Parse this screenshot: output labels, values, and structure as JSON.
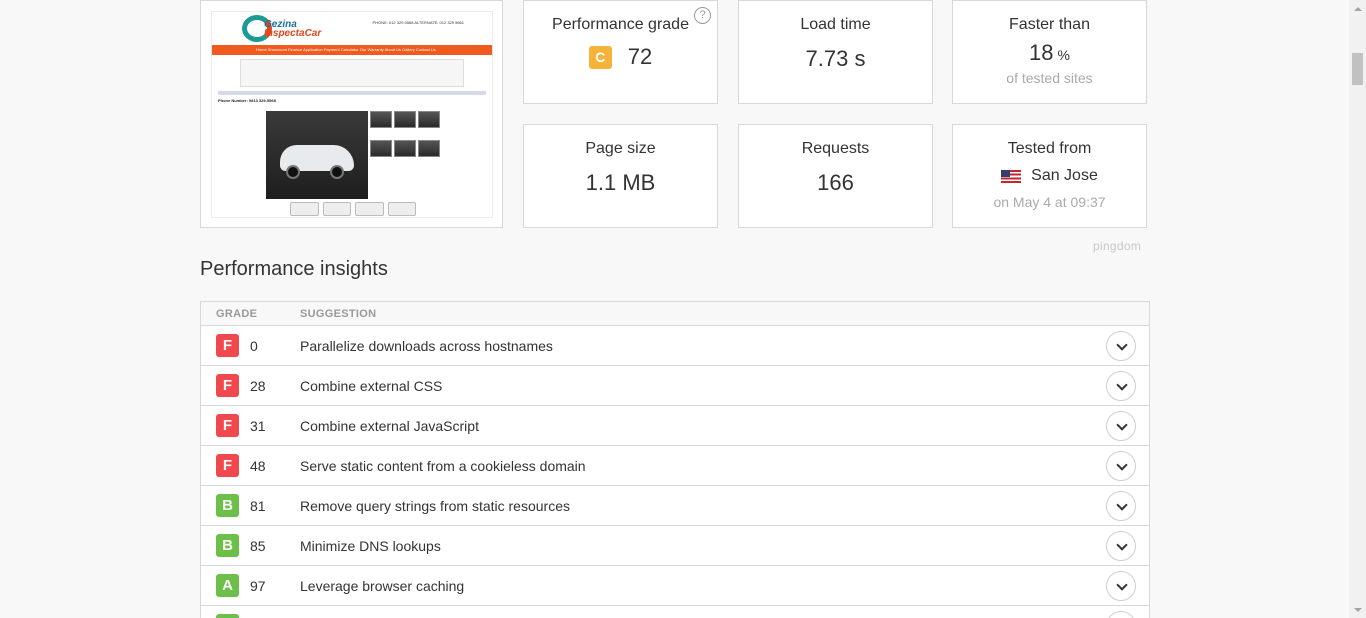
{
  "screenshot": {
    "logo_line1": "Gezina",
    "logo_line2": "InspectaCar",
    "contact": "PHONE: 012 329 5568\nALTERNATE: 012 329 5661",
    "nav": "Home  Showroom  Finance Application  Payment Calculator  Our Warranty  About Us  Gallery  Contact Us",
    "phone_label": "Phone Number: 0813 329-5568"
  },
  "metrics": {
    "performance_grade": {
      "title": "Performance grade",
      "letter": "C",
      "value": "72"
    },
    "load_time": {
      "title": "Load time",
      "value": "7.73 s"
    },
    "faster_than": {
      "title": "Faster than",
      "value": "18",
      "unit": "%",
      "sub": "of tested sites"
    },
    "page_size": {
      "title": "Page size",
      "value": "1.1 MB"
    },
    "requests": {
      "title": "Requests",
      "value": "166"
    },
    "tested_from": {
      "title": "Tested from",
      "location": "San Jose",
      "sub": "on May 4 at 09:37"
    }
  },
  "brand": "pingdom",
  "insights": {
    "title": "Performance insights",
    "columns": {
      "grade": "GRADE",
      "suggestion": "SUGGESTION"
    },
    "rows": [
      {
        "grade": "F",
        "score": "0",
        "text": "Parallelize downloads across hostnames"
      },
      {
        "grade": "F",
        "score": "28",
        "text": "Combine external CSS"
      },
      {
        "grade": "F",
        "score": "31",
        "text": "Combine external JavaScript"
      },
      {
        "grade": "F",
        "score": "48",
        "text": "Serve static content from a cookieless domain"
      },
      {
        "grade": "B",
        "score": "81",
        "text": "Remove query strings from static resources"
      },
      {
        "grade": "B",
        "score": "85",
        "text": "Minimize DNS lookups"
      },
      {
        "grade": "A",
        "score": "97",
        "text": "Leverage browser caching"
      },
      {
        "grade": "A",
        "score": "",
        "text": ""
      }
    ]
  },
  "colors": {
    "grade_F": "#f0484d",
    "grade_B": "#6cc04a",
    "grade_A": "#6cc04a",
    "grade_C": "#f5b339"
  }
}
